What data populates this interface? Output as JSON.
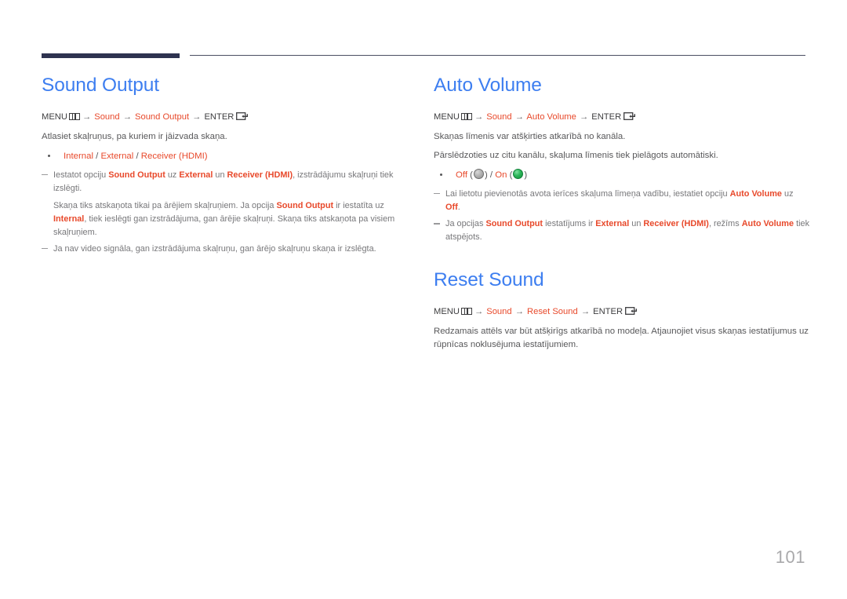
{
  "header": {
    "rule_color_thick": "#2e3350",
    "rule_color_thin": "#4a4f63"
  },
  "colors": {
    "title_blue": "#3d7ef0",
    "highlight_orange": "#e8492b",
    "body_gray": "#58585a",
    "note_gray": "#77777a",
    "page_number_gray": "#a9a9ab"
  },
  "left_column": {
    "sections": [
      {
        "title": "Sound Output",
        "menu_path": {
          "menu_label": "MENU",
          "menu_icon": "menu-icon",
          "arrow": "→",
          "step1": "Sound",
          "step2": "Sound Output",
          "enter_label": "ENTER",
          "enter_icon": "enter-icon"
        },
        "intro": "Atlasiet skaļruņus, pa kuriem ir jāizvada skaņa.",
        "bullet": {
          "opt1": "Internal",
          "sep1": " / ",
          "opt2": "External",
          "sep2": " / ",
          "opt3": "Receiver (HDMI)"
        },
        "notes": [
          {
            "type": "dash",
            "parts": [
              {
                "t": "Iestatot opciju ",
                "hl": false
              },
              {
                "t": "Sound Output",
                "hl": true
              },
              {
                "t": " uz ",
                "hl": false
              },
              {
                "t": "External",
                "hl": true
              },
              {
                "t": " un ",
                "hl": false
              },
              {
                "t": "Receiver (HDMI)",
                "hl": true
              },
              {
                "t": ", izstrādājumu skaļruņi tiek izslēgti.",
                "hl": false
              }
            ]
          },
          {
            "type": "continuation",
            "parts": [
              {
                "t": "Skaņa tiks atskaņota tikai pa ārējiem skaļruņiem. Ja opcija ",
                "hl": false
              },
              {
                "t": "Sound Output",
                "hl": true
              },
              {
                "t": " ir iestatīta uz ",
                "hl": false
              },
              {
                "t": "Internal",
                "hl": true
              },
              {
                "t": ", tiek ieslēgti gan izstrādājuma, gan ārējie skaļruņi. Skaņa tiks atskaņota pa visiem skaļruņiem.",
                "hl": false
              }
            ]
          },
          {
            "type": "dash",
            "parts": [
              {
                "t": "Ja nav video signāla, gan izstrādājuma skaļruņu, gan ārējo skaļruņu skaņa ir izslēgta.",
                "hl": false
              }
            ]
          }
        ]
      }
    ]
  },
  "right_column": {
    "sections": [
      {
        "title": "Auto Volume",
        "menu_path": {
          "menu_label": "MENU",
          "menu_icon": "menu-icon",
          "arrow": "→",
          "step1": "Sound",
          "step2": "Auto Volume",
          "enter_label": "ENTER",
          "enter_icon": "enter-icon"
        },
        "intro_lines": [
          "Skaņas līmenis var atšķirties atkarībā no kanāla.",
          "Pārslēdzoties uz citu kanālu, skaļuma līmenis tiek pielāgots automātiski."
        ],
        "toggle_bullet": {
          "off_label": "Off",
          "off_indicator": "toggle-off-icon",
          "separator": " / ",
          "on_label": "On",
          "on_indicator": "toggle-on-icon",
          "open_paren": "(",
          "close_paren": ")"
        },
        "notes": [
          {
            "type": "dash",
            "parts": [
              {
                "t": "Lai lietotu pievienotās avota ierīces skaļuma līmeņa vadību, iestatiet opciju ",
                "hl": false
              },
              {
                "t": "Auto Volume",
                "hl": true
              },
              {
                "t": " uz ",
                "hl": false
              },
              {
                "t": "Off",
                "hl": true
              },
              {
                "t": ".",
                "hl": false
              }
            ]
          },
          {
            "type": "dash",
            "parts": [
              {
                "t": "Ja opcijas ",
                "hl": false
              },
              {
                "t": "Sound Output",
                "hl": true
              },
              {
                "t": " iestatījums ir ",
                "hl": false
              },
              {
                "t": "External",
                "hl": true
              },
              {
                "t": " un ",
                "hl": false
              },
              {
                "t": "Receiver (HDMI)",
                "hl": true
              },
              {
                "t": ", režīms ",
                "hl": false
              },
              {
                "t": "Auto Volume",
                "hl": true
              },
              {
                "t": " tiek atspējots.",
                "hl": false
              }
            ]
          }
        ]
      },
      {
        "title": "Reset Sound",
        "menu_path": {
          "menu_label": "MENU",
          "menu_icon": "menu-icon",
          "arrow": "→",
          "step1": "Sound",
          "step2": "Reset Sound",
          "enter_label": "ENTER",
          "enter_icon": "enter-icon"
        },
        "intro": "Redzamais attēls var būt atšķirīgs atkarībā no modeļa. Atjaunojiet visus skaņas iestatījumus uz rūpnīcas noklusējuma iestatījumiem."
      }
    ]
  },
  "footer": {
    "page_number": "101"
  }
}
